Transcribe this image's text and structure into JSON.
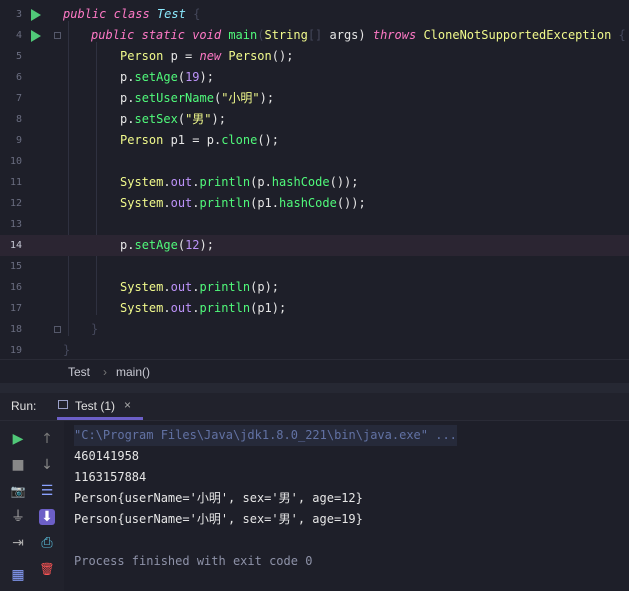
{
  "editor": {
    "lines": [
      {
        "num": "3",
        "gutter": "run",
        "fold": false
      },
      {
        "num": "4",
        "gutter": "run",
        "fold": true
      },
      {
        "num": "5"
      },
      {
        "num": "6"
      },
      {
        "num": "7"
      },
      {
        "num": "8"
      },
      {
        "num": "9"
      },
      {
        "num": "10"
      },
      {
        "num": "11"
      },
      {
        "num": "12"
      },
      {
        "num": "13"
      },
      {
        "num": "14",
        "current": true
      },
      {
        "num": "15"
      },
      {
        "num": "16"
      },
      {
        "num": "17"
      },
      {
        "num": "18",
        "fold": true
      },
      {
        "num": "19"
      }
    ],
    "code": {
      "l3": {
        "kw1": "public",
        "kw2": "class",
        "name": "Test",
        "brace": " {"
      },
      "l4": {
        "kw1": "public",
        "kw2": "static",
        "kw3": "void",
        "fn": "main",
        "p1": "(",
        "type": "String",
        "arr": "[]",
        "arg": " args) ",
        "kw4": "throws",
        "exc": "CloneNotSupportedException",
        "brace": " {"
      },
      "l5": {
        "type": "Person",
        "rest": " p = ",
        "kw": "new",
        "type2": "Person",
        "tail": "();"
      },
      "l6": {
        "obj": "p",
        "dot": ".",
        "fn": "setAge",
        "open": "(",
        "num": "19",
        "close": ");"
      },
      "l7": {
        "obj": "p",
        "dot": ".",
        "fn": "setUserName",
        "open": "(",
        "str": "\"小明\"",
        "close": ");"
      },
      "l8": {
        "obj": "p",
        "dot": ".",
        "fn": "setSex",
        "open": "(",
        "str": "\"男\"",
        "close": ");"
      },
      "l9": {
        "type": "Person",
        "rest": " p1 = ",
        "obj": "p",
        "dot": ".",
        "fn": "clone",
        "tail": "();"
      },
      "l11": {
        "cls": "System",
        "dot1": ".",
        "field": "out",
        "dot2": ".",
        "fn": "println",
        "open": "(",
        "obj": "p",
        "dot3": ".",
        "fn2": "hashCode",
        "close": "());"
      },
      "l12": {
        "cls": "System",
        "dot1": ".",
        "field": "out",
        "dot2": ".",
        "fn": "println",
        "open": "(",
        "obj": "p1",
        "dot3": ".",
        "fn2": "hashCode",
        "close": "());"
      },
      "l14": {
        "obj": "p",
        "dot": ".",
        "fn": "setAge",
        "open": "(",
        "num": "12",
        "close": ");"
      },
      "l16": {
        "cls": "System",
        "dot1": ".",
        "field": "out",
        "dot2": ".",
        "fn": "println",
        "open": "(",
        "obj": "p",
        "close": ");"
      },
      "l17": {
        "cls": "System",
        "dot1": ".",
        "field": "out",
        "dot2": ".",
        "fn": "println",
        "open": "(",
        "obj": "p1",
        "close": ");"
      },
      "l18": {
        "brace": "}"
      },
      "l19": {
        "brace": "}"
      }
    }
  },
  "breadcrumb": {
    "item1": "Test",
    "sep": "›",
    "item2": "main()"
  },
  "run_panel": {
    "label": "Run:",
    "tab_label": "Test (1)",
    "close": "×"
  },
  "console": {
    "cmd": "\"C:\\Program Files\\Java\\jdk1.8.0_221\\bin\\java.exe\" ...",
    "out1": "460141958",
    "out2": "1163157884",
    "out3": "Person{userName='小明', sex='男', age=12}",
    "out4": "Person{userName='小明', sex='男', age=19}",
    "exit": "Process finished with exit code 0"
  },
  "icons": {
    "run": "▶",
    "up": "↑",
    "stop": "■",
    "down": "↓",
    "camera": "📷",
    "wrap": "☰",
    "plug": "⏚",
    "pin": "⬇",
    "exit": "⇥",
    "print": "⎙",
    "layout": "▦",
    "trash": "🗑"
  },
  "colors": {
    "keyword": "#ff79c6",
    "function": "#50fa7b",
    "number": "#bd93f9",
    "string": "#f1fa8c",
    "accent": "#6c5fc7"
  }
}
